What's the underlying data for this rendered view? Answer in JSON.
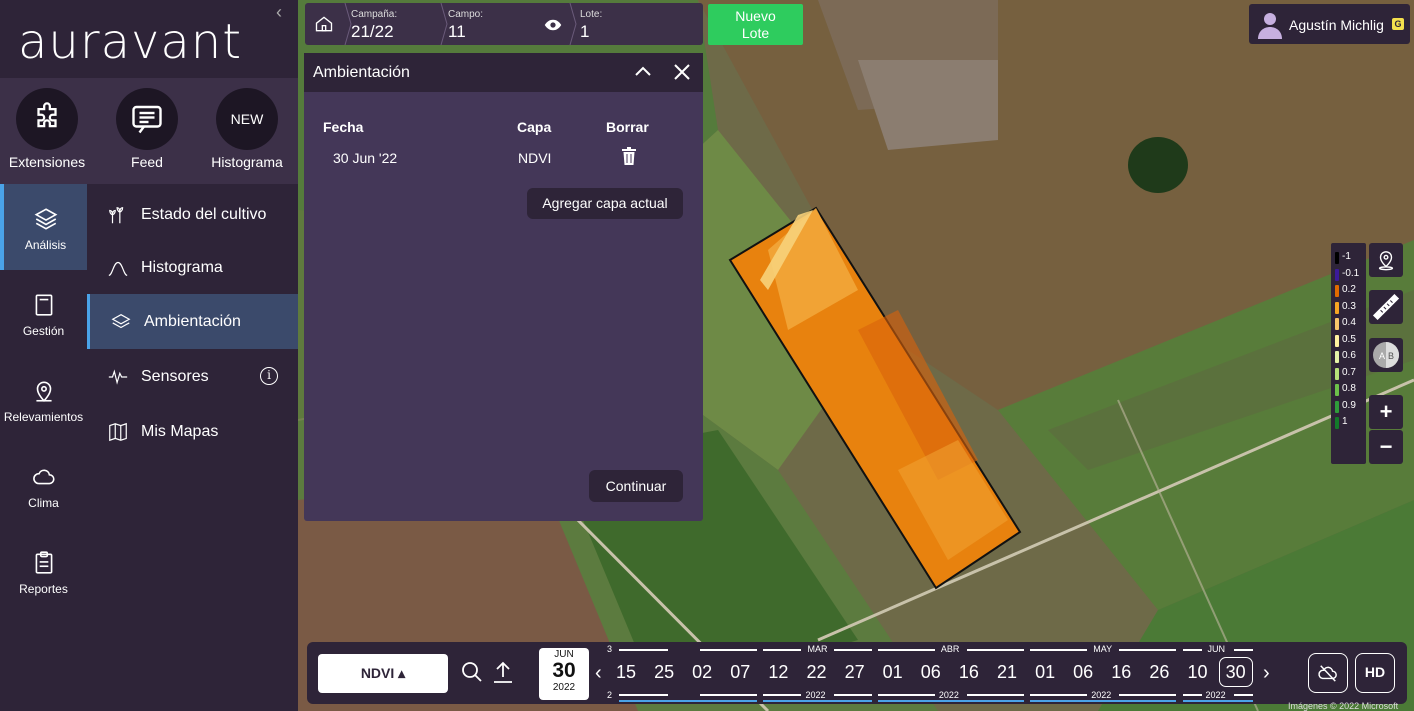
{
  "brand": {
    "logo_text": "auravant"
  },
  "quick_actions": [
    {
      "label": "Extensiones",
      "icon": "puzzle-icon"
    },
    {
      "label": "Feed",
      "icon": "chat-icon"
    },
    {
      "label": "Histograma",
      "icon": "new-badge",
      "badge": "NEW"
    }
  ],
  "rail": [
    {
      "label": "Análisis",
      "icon": "layers-icon",
      "active": true
    },
    {
      "label": "Gestión",
      "icon": "notebook-icon"
    },
    {
      "label": "Relevamientos",
      "icon": "map-pin-icon"
    },
    {
      "label": "Clima",
      "icon": "cloud-icon"
    },
    {
      "label": "Reportes",
      "icon": "clipboard-icon"
    }
  ],
  "submenu": [
    {
      "label": "Estado del cultivo",
      "icon": "plant-icon"
    },
    {
      "label": "Histograma",
      "icon": "bell-curve-icon"
    },
    {
      "label": "Ambientación",
      "icon": "layers-icon",
      "active": true
    },
    {
      "label": "Sensores",
      "icon": "waveform-icon",
      "info": "i"
    },
    {
      "label": "Mis Mapas",
      "icon": "folded-map-icon"
    }
  ],
  "breadcrumb": {
    "campaign_label": "Campaña:",
    "campaign_value": "21/22",
    "field_label": "Campo:",
    "field_value": "11",
    "lot_label": "Lote:",
    "lot_value": "1"
  },
  "new_lot_button": {
    "line1": "Nuevo",
    "line2": "Lote"
  },
  "user": {
    "name": "Agustín Michlig",
    "badge": "G"
  },
  "panel": {
    "title": "Ambientación",
    "columns": {
      "date": "Fecha",
      "layer": "Capa",
      "delete": "Borrar"
    },
    "rows": [
      {
        "date": "30 Jun '22",
        "layer": "NDVI"
      }
    ],
    "add_layer_button": "Agregar capa actual",
    "continue_button": "Continuar"
  },
  "legend": [
    {
      "label": "-1",
      "color": "#000000"
    },
    {
      "label": "-0.1",
      "color": "#3b1a9a"
    },
    {
      "label": "0.2",
      "color": "#e06b00"
    },
    {
      "label": "0.3",
      "color": "#f5a623"
    },
    {
      "label": "0.4",
      "color": "#f7c66b"
    },
    {
      "label": "0.5",
      "color": "#fff3a0"
    },
    {
      "label": "0.6",
      "color": "#e4f3a8"
    },
    {
      "label": "0.7",
      "color": "#b6e07a"
    },
    {
      "label": "0.8",
      "color": "#6cc04a"
    },
    {
      "label": "0.9",
      "color": "#2f9c3a"
    },
    {
      "label": "1",
      "color": "#137a2a"
    }
  ],
  "map_tools": [
    {
      "name": "location-pin-tool-icon"
    },
    {
      "name": "ruler-icon"
    },
    {
      "name": "compare-ab-icon",
      "a": "A",
      "b": "B"
    },
    {
      "name": "zoom-in-button",
      "text": "+"
    },
    {
      "name": "zoom-out-button",
      "text": "−"
    }
  ],
  "timeline": {
    "layer_selector": "NDVI ▴",
    "current": {
      "month": "JUN",
      "day": "30",
      "year": "2022"
    },
    "prev_arrow": "‹",
    "next_arrow": "›",
    "days": [
      "15",
      "25",
      "02",
      "07",
      "12",
      "22",
      "27",
      "01",
      "06",
      "16",
      "21",
      "01",
      "06",
      "16",
      "26",
      "10",
      "30"
    ],
    "selected_day": "30",
    "months": [
      "3",
      "MAR",
      "ABR",
      "MAY",
      "JUN"
    ],
    "years": [
      "2",
      "2022",
      "2022",
      "2022",
      "2022"
    ],
    "hd_label": "HD"
  },
  "attribution": "Imágenes © 2022 Microsoft"
}
